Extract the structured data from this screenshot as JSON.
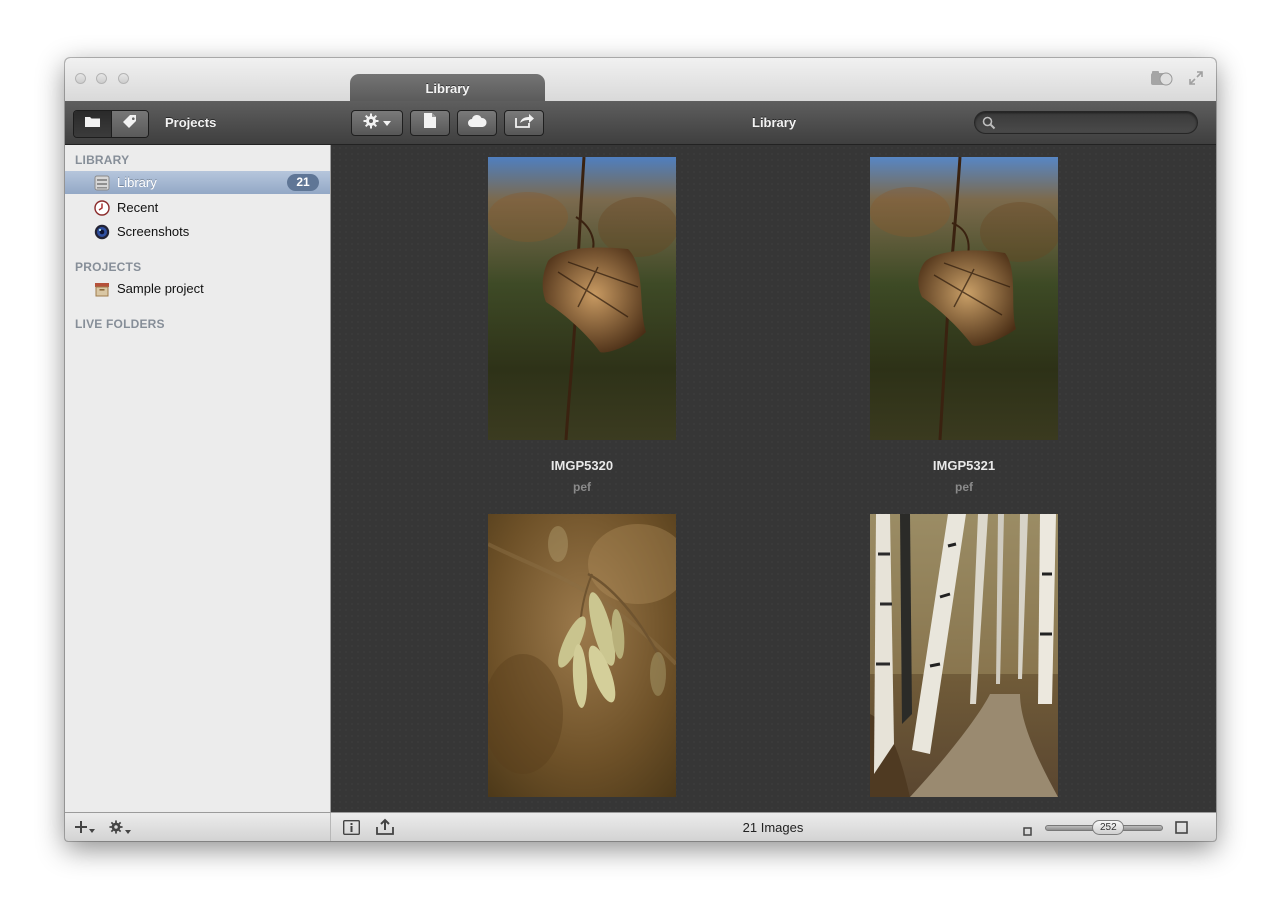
{
  "window": {
    "tab_title": "Library"
  },
  "toolbar": {
    "view_label": "Projects",
    "center_title": "Library",
    "search_placeholder": "",
    "buttons": [
      {
        "name": "settings-menu-button",
        "icon": "gear-icon"
      },
      {
        "name": "new-document-button",
        "icon": "document-icon"
      },
      {
        "name": "cloud-button",
        "icon": "cloud-icon"
      },
      {
        "name": "share-button",
        "icon": "share-arrow-icon"
      }
    ]
  },
  "sidebar": {
    "sections": [
      {
        "title": "LIBRARY",
        "items": [
          {
            "label": "Library",
            "badge": "21",
            "selected": true,
            "icon": "library-drawer-icon"
          },
          {
            "label": "Recent",
            "selected": false,
            "icon": "clock-icon"
          },
          {
            "label": "Screenshots",
            "selected": false,
            "icon": "camera-lens-icon"
          }
        ]
      },
      {
        "title": "PROJECTS",
        "items": [
          {
            "label": "Sample project",
            "selected": false,
            "icon": "box-icon"
          }
        ]
      },
      {
        "title": "LIVE FOLDERS",
        "items": []
      }
    ]
  },
  "grid": {
    "items": [
      {
        "name": "IMGP5320",
        "type": "pef",
        "subject": "dry-leaf-on-twig"
      },
      {
        "name": "IMGP5321",
        "type": "pef",
        "subject": "dry-leaf-on-twig"
      },
      {
        "name": "",
        "type": "",
        "subject": "catkins"
      },
      {
        "name": "",
        "type": "",
        "subject": "birch-path"
      }
    ]
  },
  "status": {
    "count_label": "21 Images",
    "zoom_value": "252",
    "zoom_fraction": 0.55
  },
  "colors": {
    "selection": "#9aaecb",
    "content_bg": "#363636",
    "badge": "#5f7696"
  }
}
